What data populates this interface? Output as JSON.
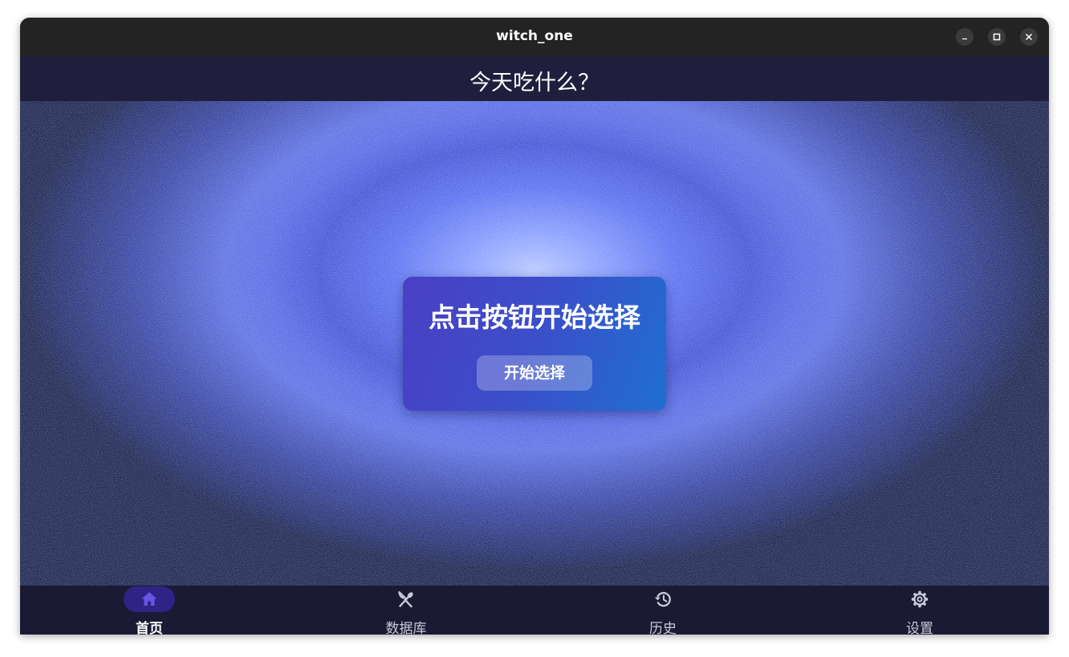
{
  "window": {
    "title": "witch_one"
  },
  "appbar": {
    "title": "今天吃什么？"
  },
  "main": {
    "card": {
      "heading": "点击按钮开始选择",
      "button_label": "开始选择"
    }
  },
  "bottom_nav": {
    "items": [
      {
        "label": "首页",
        "icon": "home-icon",
        "active": true
      },
      {
        "label": "数据库",
        "icon": "utensils-icon",
        "active": false
      },
      {
        "label": "历史",
        "icon": "history-icon",
        "active": false
      },
      {
        "label": "设置",
        "icon": "gear-icon",
        "active": false
      }
    ]
  },
  "colors": {
    "titlebar": "#232323",
    "appbar": "#1f1f3d",
    "bottom_nav": "#1b1a34",
    "active_indicator": "#2f2486",
    "active_icon": "#6b52e8",
    "card_start": "#4a3fc4",
    "card_end": "#1f6fd1"
  }
}
